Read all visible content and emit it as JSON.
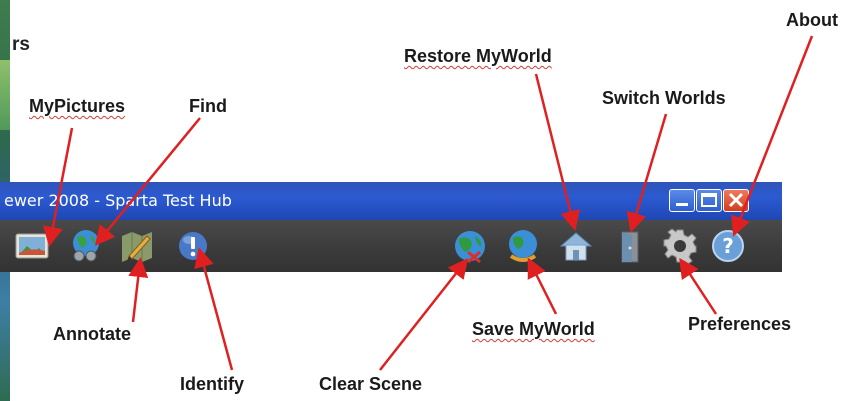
{
  "partial_text": "rs",
  "window": {
    "title": "ewer 2008 - Sparta Test Hub",
    "controls": [
      "minimize",
      "maximize",
      "close"
    ]
  },
  "toolbar": {
    "items": [
      {
        "name": "mypictures-button",
        "icon": "picture-icon"
      },
      {
        "name": "find-button",
        "icon": "globe-binoculars-icon"
      },
      {
        "name": "annotate-button",
        "icon": "map-pencil-icon"
      },
      {
        "name": "identify-button",
        "icon": "info-globe-icon"
      },
      {
        "name": "clear-scene-button",
        "icon": "globe-x-icon"
      },
      {
        "name": "save-myworld-button",
        "icon": "globe-save-icon"
      },
      {
        "name": "restore-myworld-button",
        "icon": "home-icon"
      },
      {
        "name": "switch-worlds-button",
        "icon": "door-icon"
      },
      {
        "name": "preferences-button",
        "icon": "gear-icon"
      },
      {
        "name": "about-button",
        "icon": "help-icon"
      }
    ]
  },
  "callouts": {
    "mypictures": "MyPictures",
    "find": "Find",
    "annotate": "Annotate",
    "identify": "Identify",
    "clear_scene": "Clear Scene",
    "save_myworld": "Save MyWorld",
    "restore_myworld": "Restore MyWorld",
    "switch_worlds": "Switch Worlds",
    "preferences": "Preferences",
    "about": "About"
  },
  "colors": {
    "titlebar": "#2c5ad2",
    "toolbar": "#3a3a3a",
    "arrow": "#e02020",
    "close_button": "#d9452a"
  }
}
